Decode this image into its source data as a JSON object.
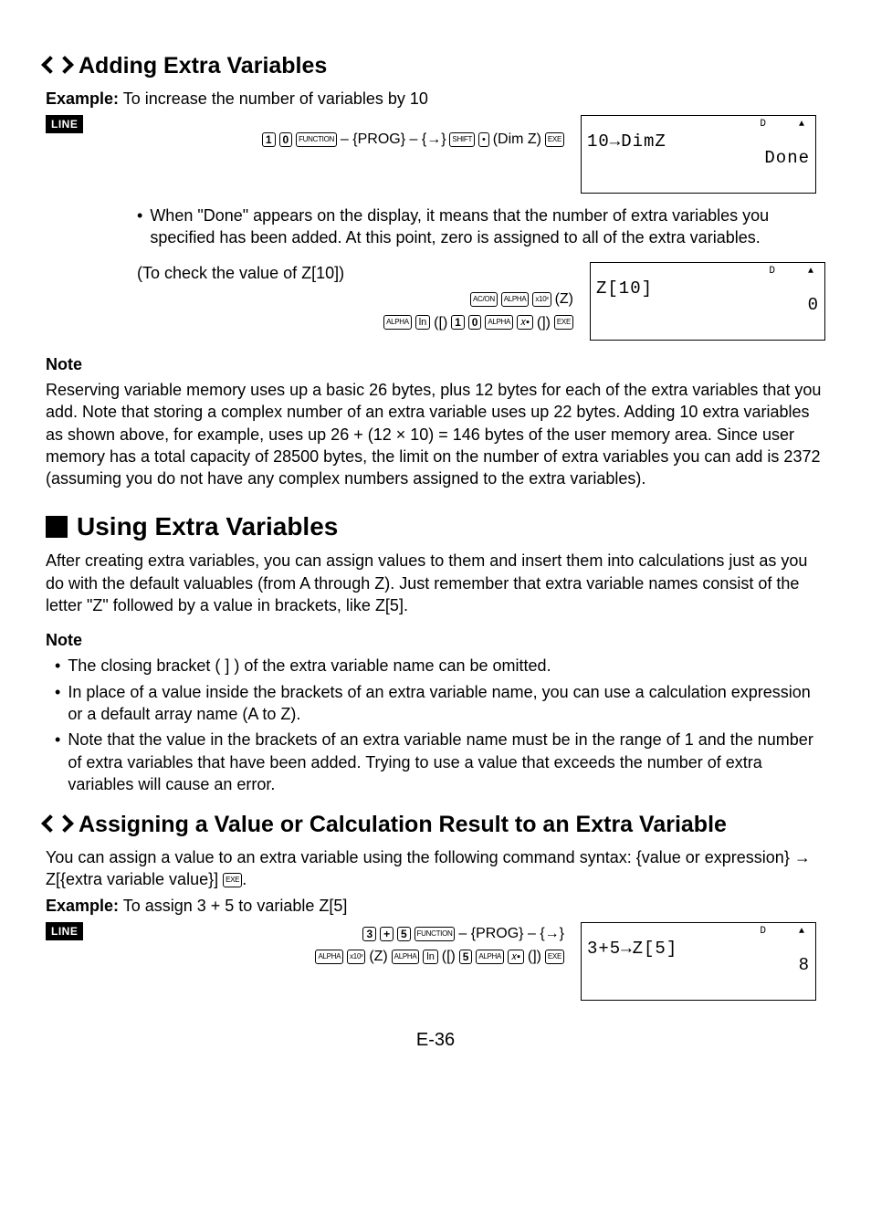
{
  "sec1": {
    "title": "Adding Extra Variables",
    "example_label": "Example:",
    "example_text": " To increase the number of variables by 10",
    "badge": "LINE",
    "keyseq_text": " – {PROG} – {→}",
    "keyseq_text2": "(Dim Z)",
    "lcd": {
      "status_d": "D",
      "line1": "10→DimZ",
      "line2": "Done"
    },
    "bullet": "When \"Done\" appears on the display, it means that the number of extra variables you specified has been added. At this point, zero is assigned to all of the extra variables.",
    "check_label": "(To check the value of Z[10])",
    "keyseq2_z": "(Z)",
    "keyseq2_open": "([)",
    "keyseq2_close": "(])",
    "lcd2": {
      "status_d": "D",
      "line1": "Z[10]",
      "line2": "0"
    }
  },
  "note1": {
    "title": "Note",
    "body": "Reserving variable memory uses up a basic 26 bytes, plus 12 bytes for each of the extra variables that you add. Note that storing a complex number of an extra variable uses up 22 bytes. Adding 10 extra variables as shown above, for example, uses up 26 + (12 × 10) = 146 bytes of the user memory area. Since user memory has a total capacity of 28500 bytes, the limit on the number of extra variables you can add is 2372 (assuming you do not have any complex numbers assigned to the extra variables)."
  },
  "sec2": {
    "title": "Using Extra Variables",
    "body": "After creating extra variables, you can assign values to them and insert them into calculations just as you do with the default valuables (from A through Z). Just remember that extra variable names consist of the letter \"Z\" followed by a value in brackets, like Z[5]."
  },
  "note2": {
    "title": "Note",
    "b1": "The closing bracket ( ] ) of the extra variable name can be omitted.",
    "b2": "In place of a value inside the brackets of an extra variable name, you can use a calculation expression or a default array name (A to Z).",
    "b3": "Note that the value in the brackets of an extra variable name must be in the range of 1 and the number of extra variables that have been added. Trying to use a value that exceeds the number of extra variables will cause an error."
  },
  "sec3": {
    "title": "Assigning a Value or Calculation Result to an Extra Variable",
    "body_pre": "You can assign a value to an extra variable using the following command syntax: {value or expression} → Z[{extra variable value}] ",
    "body_post": ".",
    "example_label": "Example:",
    "example_text": " To assign 3 + 5 to variable Z[5]",
    "badge": "LINE",
    "keyseq_text": " – {PROG} – {→}",
    "lcd": {
      "status_d": "D",
      "line1": "3+5→Z[5]",
      "line2": "8"
    }
  },
  "keys": {
    "one": "1",
    "zero": "0",
    "three": "3",
    "five": "5",
    "function": "FUNCTION",
    "shift": "SHIFT",
    "exe": "EXE",
    "dot": "•",
    "plus": "+",
    "acon": "AC/ON",
    "alpha": "ALPHA",
    "x10x": "x10ˣ",
    "ln": "ln",
    "xsq": "𝑥▪"
  },
  "page": "E-36"
}
